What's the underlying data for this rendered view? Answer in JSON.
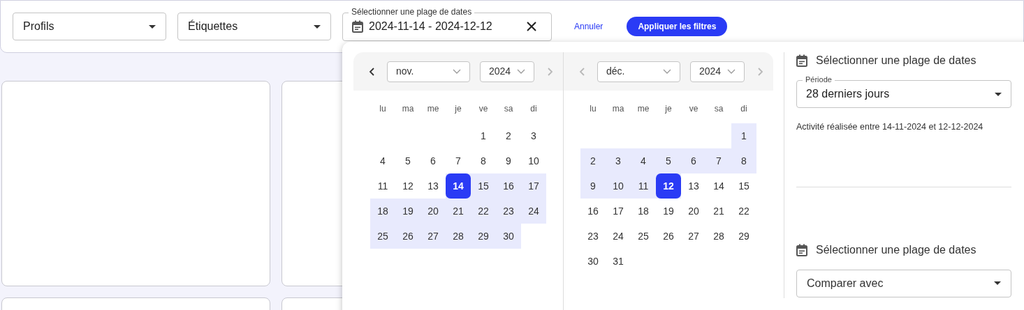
{
  "filters": {
    "profiles": {
      "value": "Profils"
    },
    "tags": {
      "value": "Étiquettes"
    },
    "date_range": {
      "label": "Sélectionner une plage de dates",
      "value": "2024-11-14 - 2024-12-12"
    },
    "cancel": "Annuler",
    "apply": "Appliquer les filtres"
  },
  "calendars": [
    {
      "month": "nov.",
      "year": "2024",
      "prev_disabled": false,
      "next_disabled": true,
      "weekdays": [
        "lu",
        "ma",
        "me",
        "je",
        "ve",
        "sa",
        "di"
      ],
      "weeks": [
        [
          {
            "kind": "empty"
          },
          {
            "kind": "empty"
          },
          {
            "kind": "empty"
          },
          {
            "kind": "empty"
          },
          {
            "kind": "day",
            "day": "1",
            "in_range": false,
            "selected": false
          },
          {
            "kind": "day",
            "day": "2",
            "in_range": false,
            "selected": false
          },
          {
            "kind": "day",
            "day": "3",
            "in_range": false,
            "selected": false
          }
        ],
        [
          {
            "kind": "day",
            "day": "4",
            "in_range": false,
            "selected": false
          },
          {
            "kind": "day",
            "day": "5",
            "in_range": false,
            "selected": false
          },
          {
            "kind": "day",
            "day": "6",
            "in_range": false,
            "selected": false
          },
          {
            "kind": "day",
            "day": "7",
            "in_range": false,
            "selected": false
          },
          {
            "kind": "day",
            "day": "8",
            "in_range": false,
            "selected": false
          },
          {
            "kind": "day",
            "day": "9",
            "in_range": false,
            "selected": false
          },
          {
            "kind": "day",
            "day": "10",
            "in_range": false,
            "selected": false
          }
        ],
        [
          {
            "kind": "day",
            "day": "11",
            "in_range": false,
            "selected": false
          },
          {
            "kind": "day",
            "day": "12",
            "in_range": false,
            "selected": false
          },
          {
            "kind": "day",
            "day": "13",
            "in_range": false,
            "selected": false
          },
          {
            "kind": "day",
            "day": "14",
            "in_range": true,
            "selected": true
          },
          {
            "kind": "day",
            "day": "15",
            "in_range": true,
            "selected": false
          },
          {
            "kind": "day",
            "day": "16",
            "in_range": true,
            "selected": false
          },
          {
            "kind": "day",
            "day": "17",
            "in_range": true,
            "selected": false
          }
        ],
        [
          {
            "kind": "day",
            "day": "18",
            "in_range": true,
            "selected": false
          },
          {
            "kind": "day",
            "day": "19",
            "in_range": true,
            "selected": false
          },
          {
            "kind": "day",
            "day": "20",
            "in_range": true,
            "selected": false
          },
          {
            "kind": "day",
            "day": "21",
            "in_range": true,
            "selected": false
          },
          {
            "kind": "day",
            "day": "22",
            "in_range": true,
            "selected": false
          },
          {
            "kind": "day",
            "day": "23",
            "in_range": true,
            "selected": false
          },
          {
            "kind": "day",
            "day": "24",
            "in_range": true,
            "selected": false
          }
        ],
        [
          {
            "kind": "day",
            "day": "25",
            "in_range": true,
            "selected": false
          },
          {
            "kind": "day",
            "day": "26",
            "in_range": true,
            "selected": false
          },
          {
            "kind": "day",
            "day": "27",
            "in_range": true,
            "selected": false
          },
          {
            "kind": "day",
            "day": "28",
            "in_range": true,
            "selected": false
          },
          {
            "kind": "day",
            "day": "29",
            "in_range": true,
            "selected": false
          },
          {
            "kind": "day",
            "day": "30",
            "in_range": true,
            "selected": false
          }
        ]
      ]
    },
    {
      "month": "déc.",
      "year": "2024",
      "prev_disabled": true,
      "next_disabled": true,
      "weekdays": [
        "lu",
        "ma",
        "me",
        "je",
        "ve",
        "sa",
        "di"
      ],
      "weeks": [
        [
          {
            "kind": "empty"
          },
          {
            "kind": "empty"
          },
          {
            "kind": "empty"
          },
          {
            "kind": "empty"
          },
          {
            "kind": "empty"
          },
          {
            "kind": "empty"
          },
          {
            "kind": "day",
            "day": "1",
            "in_range": true,
            "selected": false
          }
        ],
        [
          {
            "kind": "day",
            "day": "2",
            "in_range": true,
            "selected": false
          },
          {
            "kind": "day",
            "day": "3",
            "in_range": true,
            "selected": false
          },
          {
            "kind": "day",
            "day": "4",
            "in_range": true,
            "selected": false
          },
          {
            "kind": "day",
            "day": "5",
            "in_range": true,
            "selected": false
          },
          {
            "kind": "day",
            "day": "6",
            "in_range": true,
            "selected": false
          },
          {
            "kind": "day",
            "day": "7",
            "in_range": true,
            "selected": false
          },
          {
            "kind": "day",
            "day": "8",
            "in_range": true,
            "selected": false
          }
        ],
        [
          {
            "kind": "day",
            "day": "9",
            "in_range": true,
            "selected": false
          },
          {
            "kind": "day",
            "day": "10",
            "in_range": true,
            "selected": false
          },
          {
            "kind": "day",
            "day": "11",
            "in_range": true,
            "selected": false
          },
          {
            "kind": "day",
            "day": "12",
            "in_range": true,
            "selected": true
          },
          {
            "kind": "day",
            "day": "13",
            "in_range": false,
            "selected": false
          },
          {
            "kind": "day",
            "day": "14",
            "in_range": false,
            "selected": false
          },
          {
            "kind": "day",
            "day": "15",
            "in_range": false,
            "selected": false
          }
        ],
        [
          {
            "kind": "day",
            "day": "16",
            "in_range": false,
            "selected": false
          },
          {
            "kind": "day",
            "day": "17",
            "in_range": false,
            "selected": false
          },
          {
            "kind": "day",
            "day": "18",
            "in_range": false,
            "selected": false
          },
          {
            "kind": "day",
            "day": "19",
            "in_range": false,
            "selected": false
          },
          {
            "kind": "day",
            "day": "20",
            "in_range": false,
            "selected": false
          },
          {
            "kind": "day",
            "day": "21",
            "in_range": false,
            "selected": false
          },
          {
            "kind": "day",
            "day": "22",
            "in_range": false,
            "selected": false
          }
        ],
        [
          {
            "kind": "day",
            "day": "23",
            "in_range": false,
            "selected": false
          },
          {
            "kind": "day",
            "day": "24",
            "in_range": false,
            "selected": false
          },
          {
            "kind": "day",
            "day": "25",
            "in_range": false,
            "selected": false
          },
          {
            "kind": "day",
            "day": "26",
            "in_range": false,
            "selected": false
          },
          {
            "kind": "day",
            "day": "27",
            "in_range": false,
            "selected": false
          },
          {
            "kind": "day",
            "day": "28",
            "in_range": false,
            "selected": false
          },
          {
            "kind": "day",
            "day": "29",
            "in_range": false,
            "selected": false
          }
        ],
        [
          {
            "kind": "day",
            "day": "30",
            "in_range": false,
            "selected": false
          },
          {
            "kind": "day",
            "day": "31",
            "in_range": false,
            "selected": false
          }
        ]
      ]
    }
  ],
  "range_panel": {
    "period": {
      "title": "Sélectionner une plage de dates",
      "field_label": "Période",
      "value": "28 derniers jours",
      "summary": "Activité réalisée entre 14-11-2024 et 12-12-2024"
    },
    "compare": {
      "title": "Sélectionner une plage de dates",
      "placeholder": "Comparer avec"
    }
  }
}
